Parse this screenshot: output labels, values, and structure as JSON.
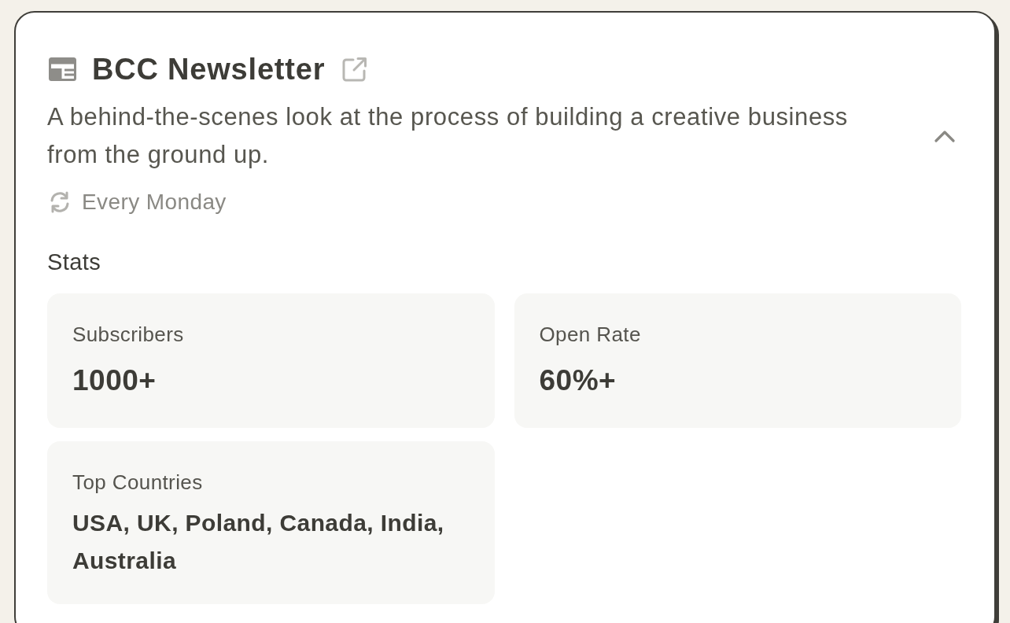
{
  "newsletter": {
    "title": "BCC Newsletter",
    "description": "A behind-the-scenes look at the process of building a creative business from the ground up.",
    "expanded": true,
    "frequency": "Every Monday"
  },
  "stats": {
    "heading": "Stats",
    "items": [
      {
        "kind": "number",
        "label": "Subscribers",
        "value": "1000+"
      },
      {
        "kind": "number",
        "label": "Open Rate",
        "value": "60%+"
      },
      {
        "kind": "list",
        "label": "Top Countries",
        "value": "USA, UK, Poland, Canada, India, Australia"
      }
    ]
  }
}
